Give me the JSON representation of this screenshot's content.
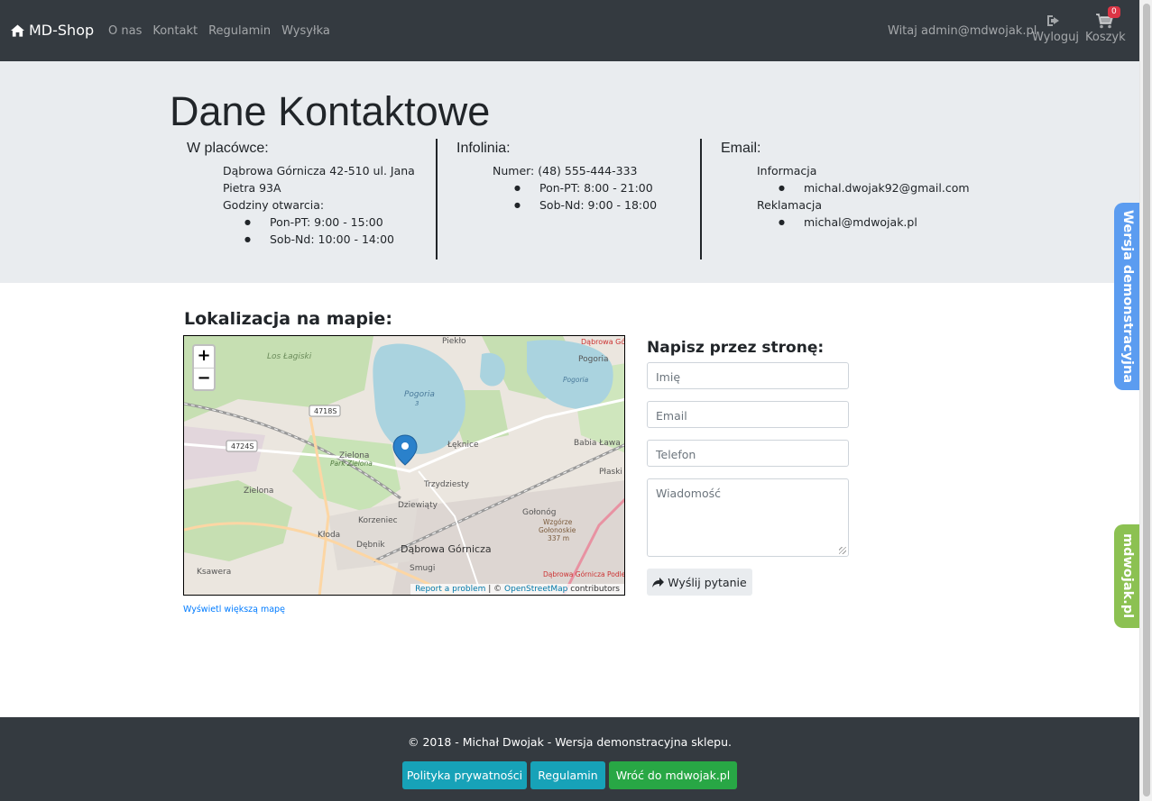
{
  "navbar": {
    "brand": "MD-Shop",
    "links": [
      "O nas",
      "Kontakt",
      "Regulamin",
      "Wysyłka"
    ],
    "greeting": "Witaj admin@mdwojak.pl",
    "logout_label": "Wyloguj",
    "cart_label": "Koszyk",
    "cart_count": "0"
  },
  "contact": {
    "title": "Dane Kontaktowe",
    "branch": {
      "heading": "W placówce:",
      "address_line1": "Dąbrowa Górnicza 42-510 ul. Jana",
      "address_line2": "Pietra 93A",
      "hours_label": "Godziny otwarcia:",
      "hours": [
        "Pon-PT: 9:00 - 15:00",
        "Sob-Nd: 10:00 - 14:00"
      ]
    },
    "hotline": {
      "heading": "Infolinia:",
      "number": "Numer: (48) 555-444-333",
      "hours": [
        "Pon-PT: 8:00 - 21:00",
        "Sob-Nd: 9:00 - 18:00"
      ]
    },
    "email": {
      "heading": "Email:",
      "info_label": "Informacja",
      "info_address": "michal.dwojak92@gmail.com",
      "complaints_label": "Reklamacja",
      "complaints_address": "michal@mdwojak.pl"
    }
  },
  "map": {
    "title": "Lokalizacja na mapie:",
    "zoom_in": "+",
    "zoom_out": "−",
    "report_link": "Report a problem",
    "attribution_sep": " | © ",
    "osm_link": "OpenStreetMap",
    "attribution_tail": " contributors",
    "bigger_map_link": "Wyświetl większą mapę",
    "labels": {
      "piekło": "Piekło",
      "dabrowa_top": "Dąbrowa Górn",
      "los_lagiski": "Los Łagiski",
      "pogoria3": "Pogoria",
      "pogoria3_num": "3",
      "pogoria": "Pogoria",
      "pogoria_lake": "Pogoria",
      "road_4718": "4718S",
      "road_4724": "4724S",
      "leknice": "Łęknice",
      "babia_lawa": "Babia Ława",
      "plaski": "Płaski",
      "zielona_park": "Zielona",
      "park_zielona": "Park Zielona",
      "zielona": "Zielona",
      "trzydziesty": "Trzydziesty",
      "dziewiaty": "Dziewiąty",
      "golonog": "Gołonóg",
      "wzgorze": "Wzgórze",
      "golonoskie": "Gołonoskie",
      "height": "337 m",
      "korzeniec": "Korzeniec",
      "kloda": "Kłoda",
      "debnik": "Dębnik",
      "dabrowa": "Dąbrowa Górnicza",
      "smugi": "Smugi",
      "ksawera": "Ksawera",
      "dabrowa_podlesie": "Dąbrowa Górnicza Podle"
    }
  },
  "form": {
    "title": "Napisz przez stronę:",
    "name_placeholder": "Imię",
    "email_placeholder": "Email",
    "phone_placeholder": "Telefon",
    "message_placeholder": "Wiadomość",
    "submit_label": "Wyślij pytanie"
  },
  "side_tabs": {
    "demo": "Wersja demonstracyjna",
    "site": "mdwojak.pl"
  },
  "footer": {
    "text": "© 2018 - Michał Dwojak - Wersja demonstracyjna sklepu.",
    "privacy_button": "Polityka prywatności",
    "terms_button": "Regulamin",
    "back_button": "Wróć do mdwojak.pl"
  }
}
